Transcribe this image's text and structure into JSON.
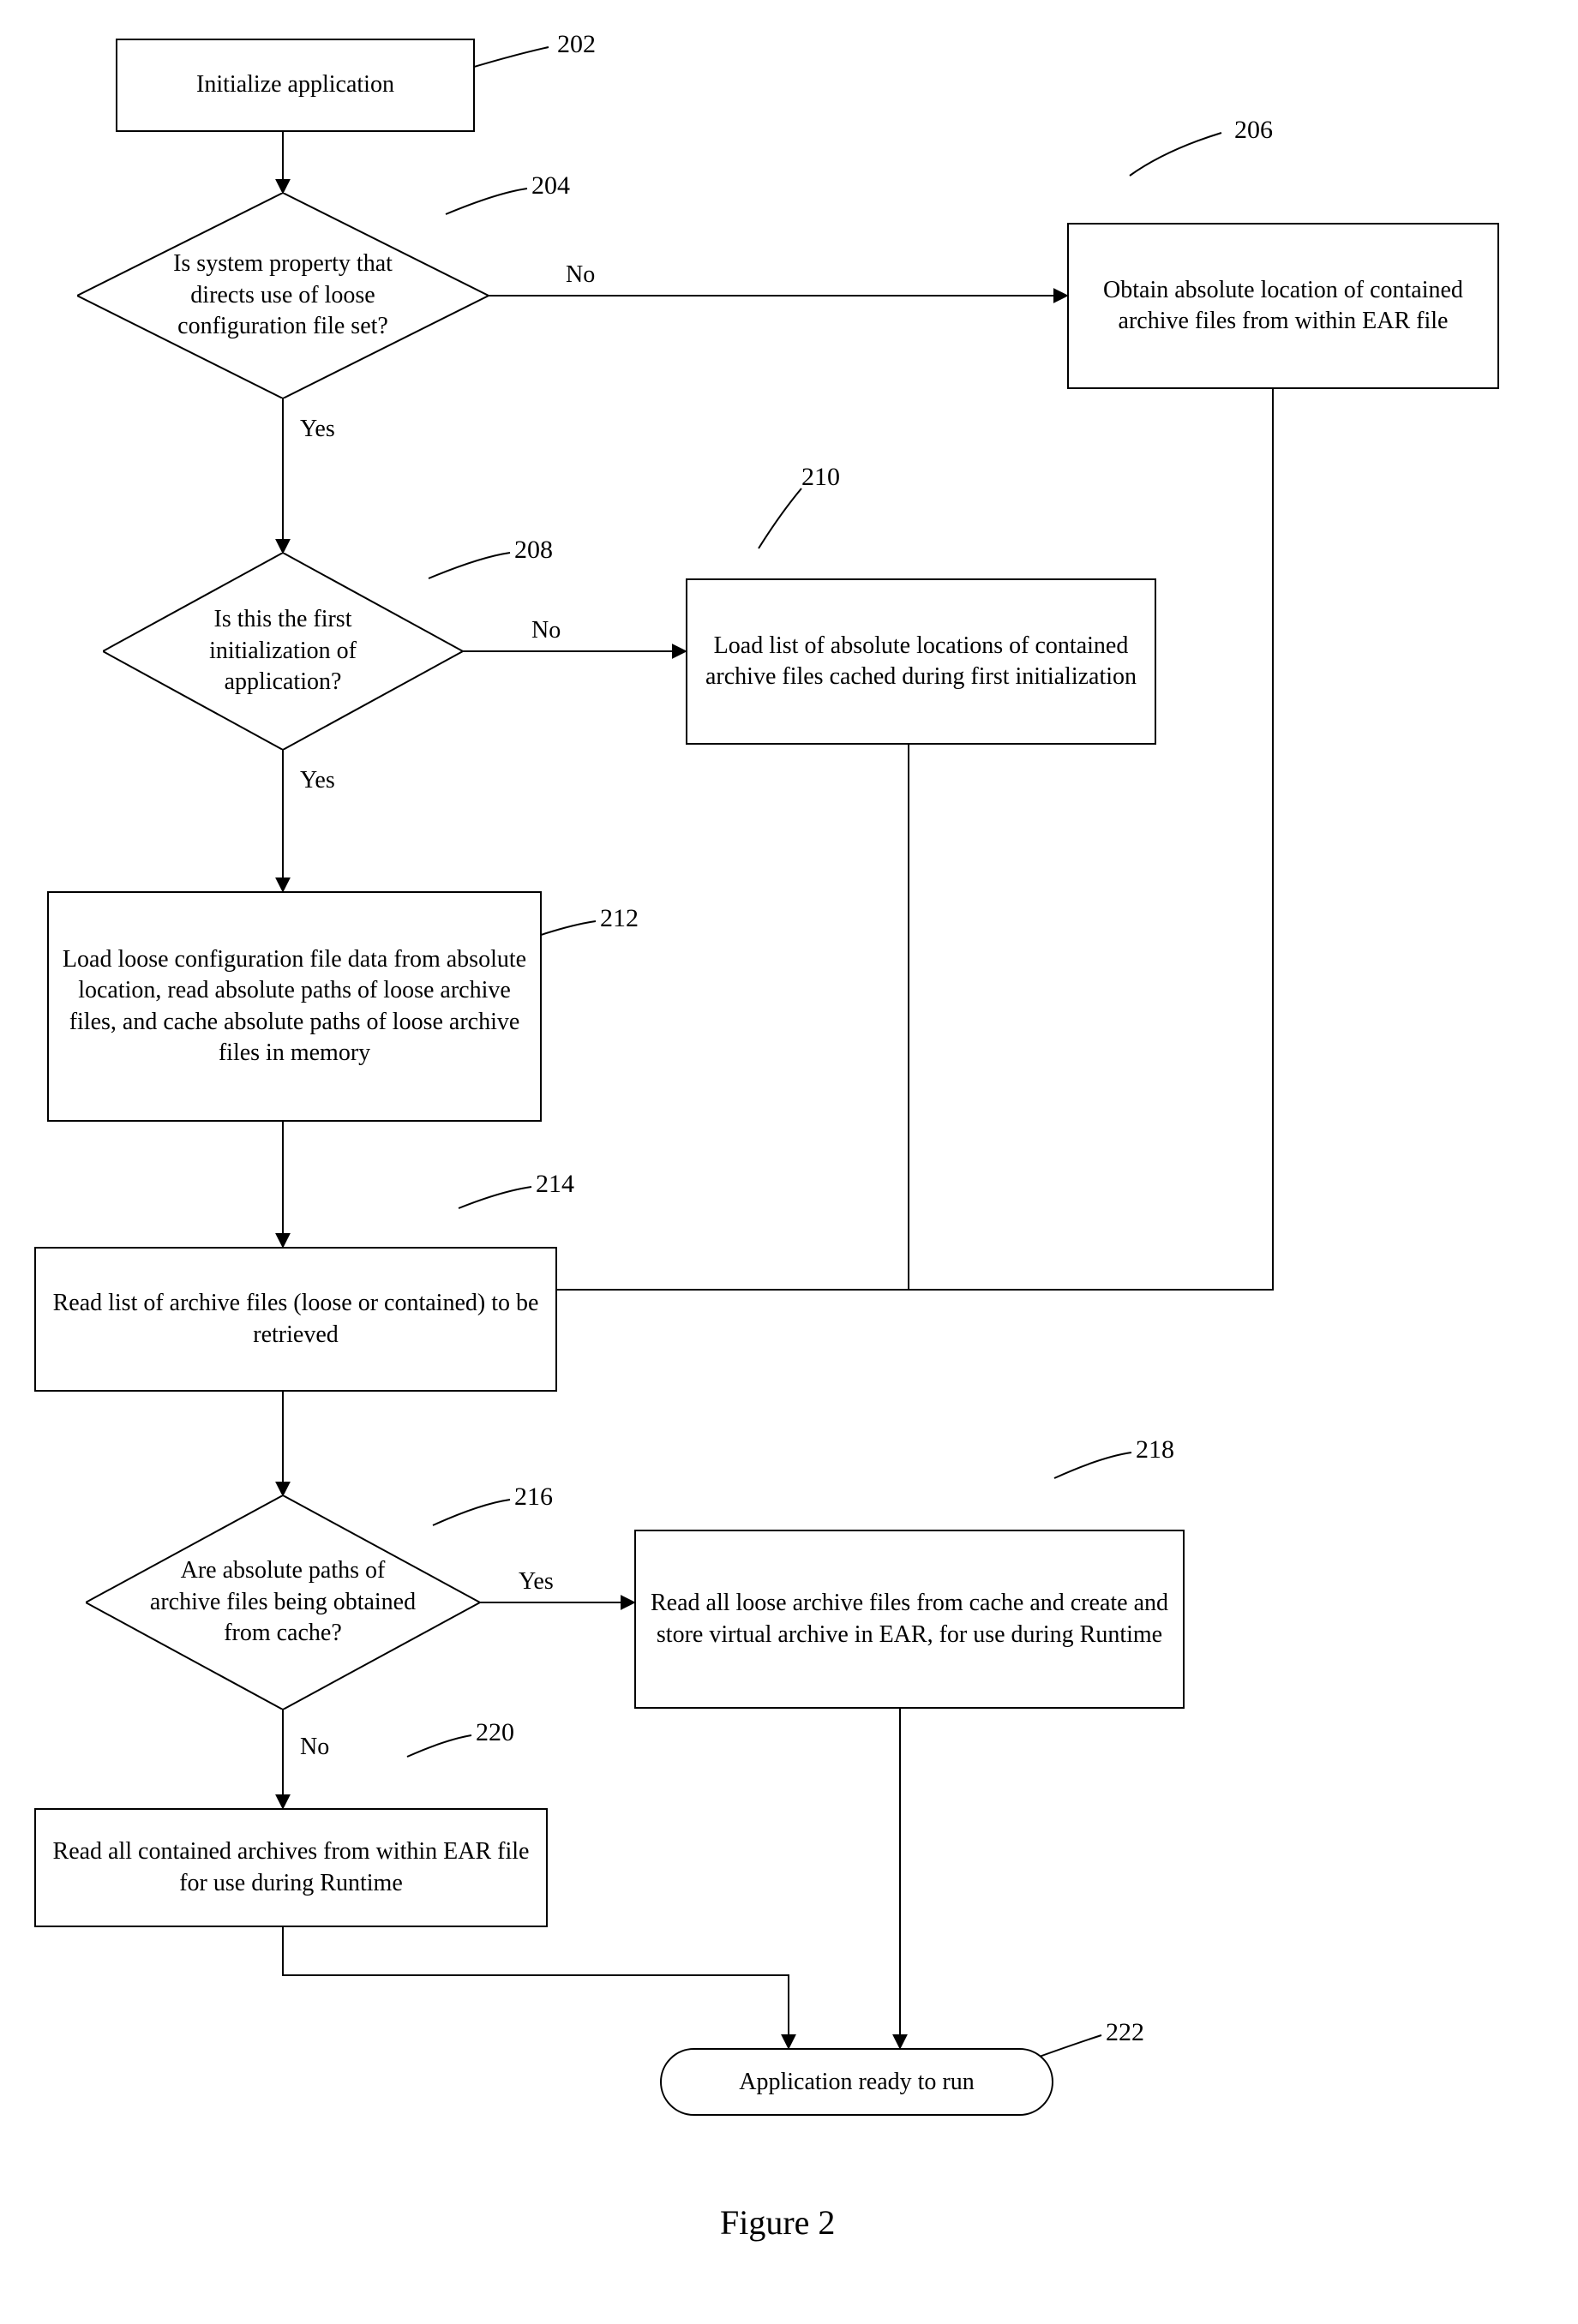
{
  "nodes": {
    "n202": {
      "text": "Initialize application",
      "ref": "202"
    },
    "n204": {
      "text": "Is system property that directs use of loose configuration file set?",
      "ref": "204"
    },
    "n206": {
      "text": "Obtain absolute location of contained archive files from within EAR file",
      "ref": "206"
    },
    "n208": {
      "text": "Is this the first initialization of application?",
      "ref": "208"
    },
    "n210": {
      "text": "Load list of absolute locations of contained archive files cached during first initialization",
      "ref": "210"
    },
    "n212": {
      "text": "Load loose configuration file data from absolute location, read absolute paths of loose archive files, and cache absolute paths of loose archive files in memory",
      "ref": "212"
    },
    "n214": {
      "text": "Read list of archive files (loose or contained) to be retrieved",
      "ref": "214"
    },
    "n216": {
      "text": "Are absolute paths of archive files being obtained from cache?",
      "ref": "216"
    },
    "n218": {
      "text": "Read all loose archive files from cache and create and store virtual archive in EAR, for use during Runtime",
      "ref": "218"
    },
    "n220": {
      "text": "Read all contained archives from within EAR file for use during Runtime",
      "ref": "220"
    },
    "n222": {
      "text": "Application ready to run",
      "ref": "222"
    }
  },
  "edgeLabels": {
    "d204_no": "No",
    "d204_yes": "Yes",
    "d208_no": "No",
    "d208_yes": "Yes",
    "d216_yes": "Yes",
    "d216_no": "No"
  },
  "figure_caption": "Figure 2"
}
